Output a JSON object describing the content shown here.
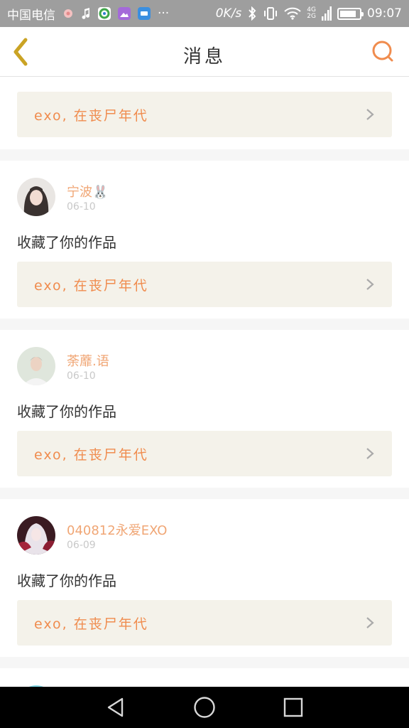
{
  "status_bar": {
    "carrier": "中国电信",
    "more": "···",
    "net_speed": "0K/s",
    "net_gen_top": "4G",
    "net_gen_bottom": "2G",
    "time": "09:07",
    "battery_level": 0.85
  },
  "header": {
    "title": "消息"
  },
  "colors": {
    "accent_orange": "#f08c4e",
    "username": "#f0a675",
    "link_bg": "#f4f2ea"
  },
  "feed": {
    "top_partial": {
      "work_title": "exo, 在丧尸年代"
    },
    "items": [
      {
        "username": "宁波🐰",
        "date": "06-10",
        "action": "收藏了你的作品",
        "work_title": "exo, 在丧尸年代"
      },
      {
        "username": "荼蘼.语",
        "date": "06-10",
        "action": "收藏了你的作品",
        "work_title": "exo, 在丧尸年代"
      },
      {
        "username": "040812永爱EXO",
        "date": "06-09",
        "action": "收藏了你的作品",
        "work_title": "exo, 在丧尸年代"
      }
    ]
  }
}
